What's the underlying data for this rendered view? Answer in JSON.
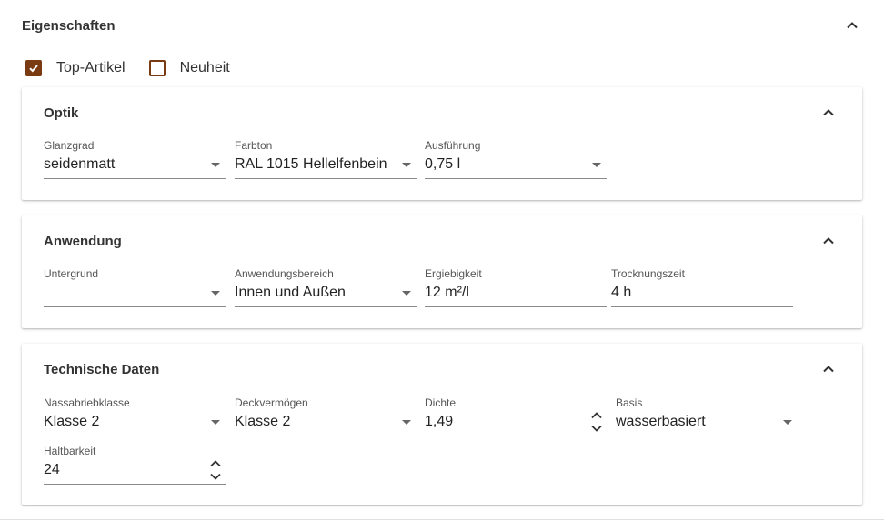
{
  "section": {
    "title": "Eigenschaften"
  },
  "checkboxes": [
    {
      "label": "Top-Artikel",
      "checked": true
    },
    {
      "label": "Neuheit",
      "checked": false
    }
  ],
  "optik": {
    "title": "Optik",
    "glanzgrad": {
      "label": "Glanzgrad",
      "value": "seidenmatt"
    },
    "farbton": {
      "label": "Farbton",
      "value": "RAL 1015 Hellelfenbein"
    },
    "ausfuehrung": {
      "label": "Ausführung",
      "value": "0,75 l"
    }
  },
  "anwendung": {
    "title": "Anwendung",
    "untergrund": {
      "label": "Untergrund",
      "value": ""
    },
    "anwendungsbereich": {
      "label": "Anwendungsbereich",
      "value": "Innen und Außen"
    },
    "ergiebigkeit": {
      "label": "Ergiebigkeit",
      "value": "12 m²/l"
    },
    "trocknungszeit": {
      "label": "Trocknungszeit",
      "value": "4 h"
    }
  },
  "technisch": {
    "title": "Technische Daten",
    "nassabriebklasse": {
      "label": "Nassabriebklasse",
      "value": "Klasse 2"
    },
    "deckvermoegen": {
      "label": "Deckvermögen",
      "value": "Klasse 2"
    },
    "dichte": {
      "label": "Dichte",
      "value": "1,49"
    },
    "basis": {
      "label": "Basis",
      "value": "wasserbasiert"
    },
    "haltbarkeit": {
      "label": "Haltbarkeit",
      "value": "24"
    }
  },
  "colors": {
    "accent": "#7a3a12",
    "text": "#333333",
    "underline": "#8a8a8a"
  },
  "icons": {
    "collapse": "chevron-up-icon",
    "dropdown": "caret-down-icon",
    "spin": "stepper-icon",
    "check": "check-icon"
  }
}
